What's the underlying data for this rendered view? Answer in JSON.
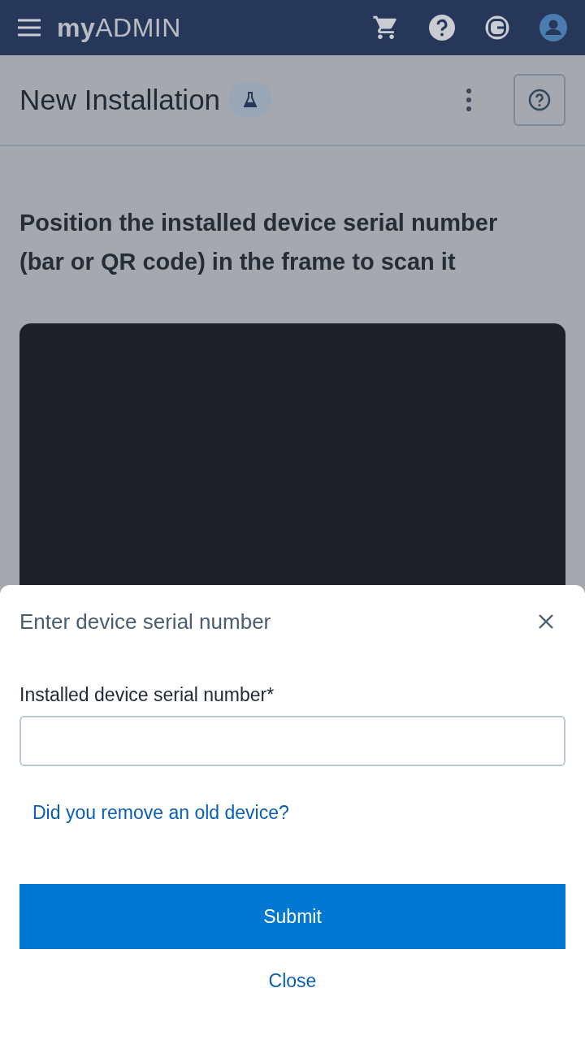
{
  "app_bar": {
    "logo": "**my**ADMIN"
  },
  "page": {
    "title": "New Installation",
    "instruction": "Position the installed device serial number (bar or QR code) in the frame to scan it"
  },
  "sheet": {
    "title": "Enter device serial number",
    "field": {
      "label": "Installed device serial number*"
    },
    "link": "Did you remove an old device?",
    "submit": "Submit",
    "close": "Close"
  }
}
